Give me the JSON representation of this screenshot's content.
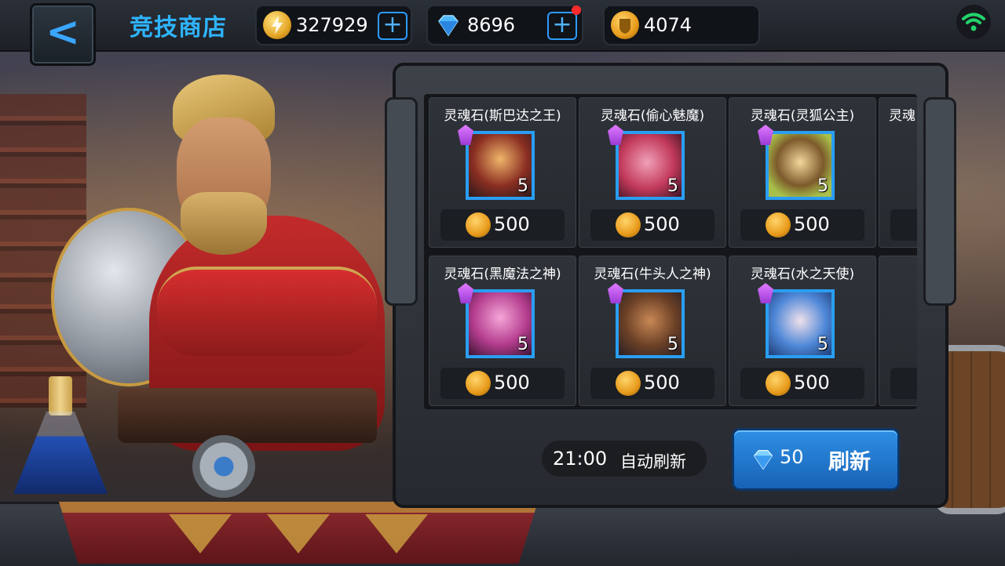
{
  "header": {
    "back_label": "<",
    "title": "竞技商店"
  },
  "resources": [
    {
      "icon": "lightning-coin-icon",
      "value": "327929",
      "has_plus": true,
      "color": "#e4a524"
    },
    {
      "icon": "diamond-icon",
      "value": "8696",
      "has_plus": true,
      "has_notification": true,
      "color": "#3aa6ff"
    },
    {
      "icon": "arena-coin-icon",
      "value": "4074",
      "has_plus": false,
      "color": "#e79a1a"
    }
  ],
  "status": {
    "wifi_icon": "wifi-icon"
  },
  "shop": {
    "items": [
      {
        "name": "灵魂石(斯巴达之王)",
        "count": "5",
        "price": "500"
      },
      {
        "name": "灵魂石(偷心魅魔)",
        "count": "5",
        "price": "500"
      },
      {
        "name": "灵魂石(灵狐公主)",
        "count": "5",
        "price": "500"
      },
      {
        "name": "灵魂石(黑魔法之神)",
        "count": "5",
        "price": "500"
      },
      {
        "name": "灵魂石(牛头人之神)",
        "count": "5",
        "price": "500"
      },
      {
        "name": "灵魂石(水之天使)",
        "count": "5",
        "price": "500"
      }
    ],
    "partial_item_name": "灵魂",
    "refresh_time": "21:00",
    "refresh_time_label": "自动刷新",
    "refresh_cost": "50",
    "refresh_label": "刷新"
  }
}
